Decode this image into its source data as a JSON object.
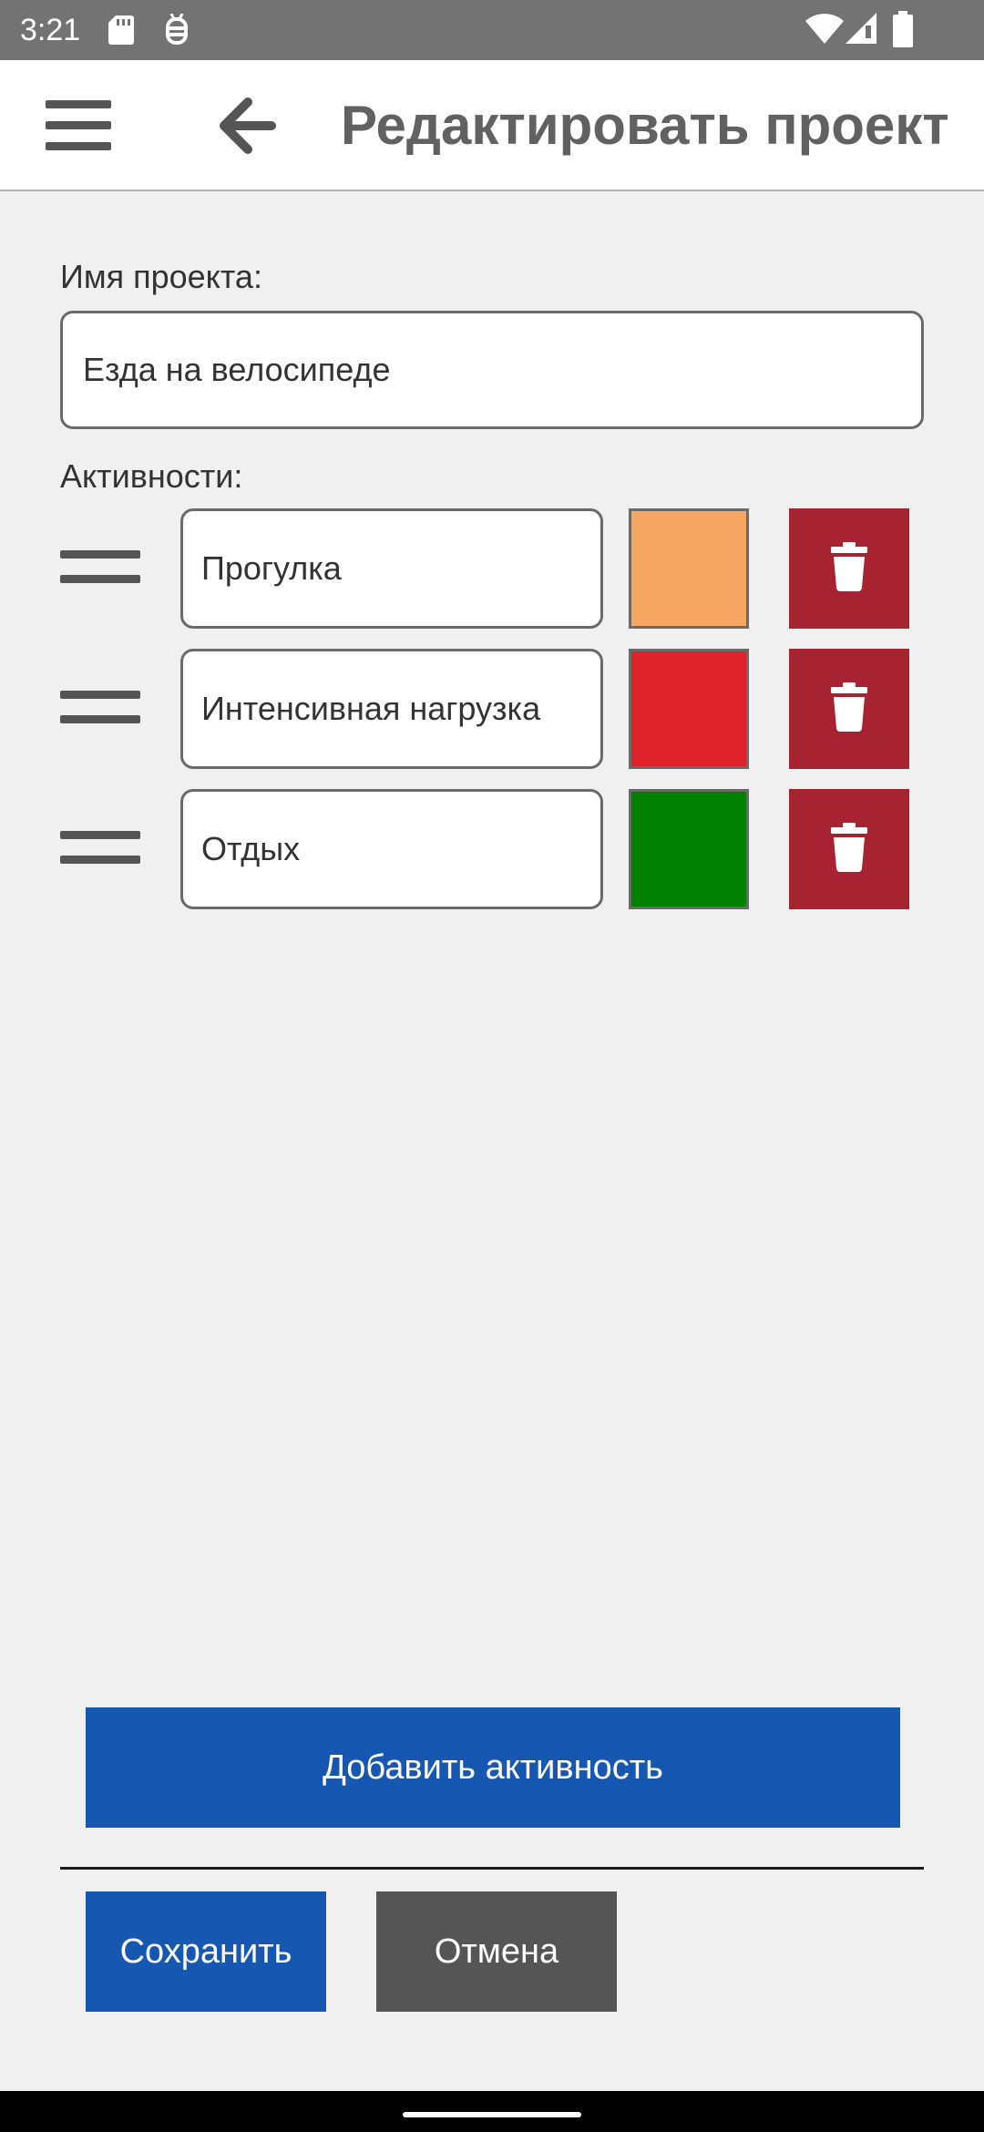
{
  "status_bar": {
    "time": "3:21",
    "icons": [
      "sd-card-icon",
      "debug-icon",
      "wifi-icon",
      "signal-icon",
      "battery-icon"
    ]
  },
  "app_bar": {
    "title": "Редактировать проект",
    "menu_icon": "menu-icon",
    "back_icon": "arrow-back-icon"
  },
  "form": {
    "project_name_label": "Имя проекта:",
    "project_name_value": "Езда на велосипеде",
    "activities_label": "Активности:",
    "activities": [
      {
        "name": "Прогулка",
        "color": "#f4a662"
      },
      {
        "name": "Интенсивная нагрузка",
        "color": "#e0232a"
      },
      {
        "name": "Отдых",
        "color": "#008000"
      }
    ]
  },
  "buttons": {
    "add_activity": "Добавить активность",
    "save": "Сохранить",
    "cancel": "Отмена"
  },
  "colors": {
    "primary": "#1658b1",
    "secondary": "#555555",
    "danger": "#a82332",
    "status_bar": "#737373",
    "background": "#f0f0f0"
  }
}
